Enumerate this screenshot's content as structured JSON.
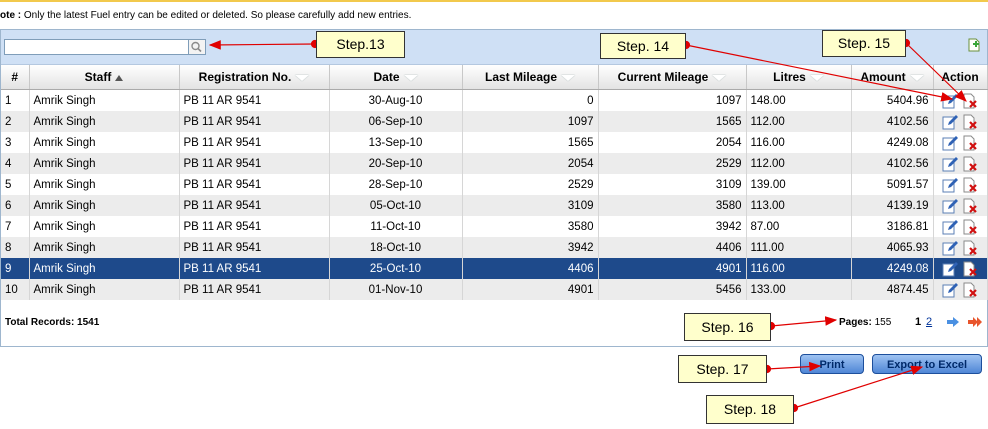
{
  "note": {
    "label": "ote :",
    "text": "Only the latest Fuel entry can be edited or deleted. So please carefully add new entries."
  },
  "search": {
    "value": "",
    "placeholder": ""
  },
  "columns": [
    "#",
    "Staff",
    "Registration No.",
    "Date",
    "Last Mileage",
    "Current Mileage",
    "Litres",
    "Amount",
    "Action"
  ],
  "rows": [
    {
      "n": "1",
      "staff": "Amrik Singh",
      "reg": "PB 11 AR 9541",
      "date": "30-Aug-10",
      "last": "0",
      "curr": "1097",
      "litres": "148.00",
      "amount": "5404.96"
    },
    {
      "n": "2",
      "staff": "Amrik Singh",
      "reg": "PB 11 AR 9541",
      "date": "06-Sep-10",
      "last": "1097",
      "curr": "1565",
      "litres": "112.00",
      "amount": "4102.56"
    },
    {
      "n": "3",
      "staff": "Amrik Singh",
      "reg": "PB 11 AR 9541",
      "date": "13-Sep-10",
      "last": "1565",
      "curr": "2054",
      "litres": "116.00",
      "amount": "4249.08"
    },
    {
      "n": "4",
      "staff": "Amrik Singh",
      "reg": "PB 11 AR 9541",
      "date": "20-Sep-10",
      "last": "2054",
      "curr": "2529",
      "litres": "112.00",
      "amount": "4102.56"
    },
    {
      "n": "5",
      "staff": "Amrik Singh",
      "reg": "PB 11 AR 9541",
      "date": "28-Sep-10",
      "last": "2529",
      "curr": "3109",
      "litres": "139.00",
      "amount": "5091.57"
    },
    {
      "n": "6",
      "staff": "Amrik Singh",
      "reg": "PB 11 AR 9541",
      "date": "05-Oct-10",
      "last": "3109",
      "curr": "3580",
      "litres": "113.00",
      "amount": "4139.19"
    },
    {
      "n": "7",
      "staff": "Amrik Singh",
      "reg": "PB 11 AR 9541",
      "date": "11-Oct-10",
      "last": "3580",
      "curr": "3942",
      "litres": "87.00",
      "amount": "3186.81"
    },
    {
      "n": "8",
      "staff": "Amrik Singh",
      "reg": "PB 11 AR 9541",
      "date": "18-Oct-10",
      "last": "3942",
      "curr": "4406",
      "litres": "111.00",
      "amount": "4065.93"
    },
    {
      "n": "9",
      "staff": "Amrik Singh",
      "reg": "PB 11 AR 9541",
      "date": "25-Oct-10",
      "last": "4406",
      "curr": "4901",
      "litres": "116.00",
      "amount": "4249.08"
    },
    {
      "n": "10",
      "staff": "Amrik Singh",
      "reg": "PB 11 AR 9541",
      "date": "01-Nov-10",
      "last": "4901",
      "curr": "5456",
      "litres": "133.00",
      "amount": "4874.45"
    }
  ],
  "selected_row": "9",
  "footer": {
    "total": "Total Records: 1541",
    "pages_label": "Pages:",
    "pages_count": "155",
    "page1": "1",
    "page2": "2"
  },
  "buttons": {
    "print": "Print",
    "export": "Export to Excel"
  },
  "callouts": [
    "Step.13",
    "Step. 14",
    "Step. 15",
    "Step. 16",
    "Step. 17",
    "Step. 18"
  ],
  "colors": {
    "header_bar": "#cfe0f5",
    "selected_row": "#1e4a8b",
    "callout_bg": "#ffffcc",
    "arrow": "#e00000",
    "button": "#4f86d6"
  },
  "icons": {
    "search": "search-icon",
    "add": "add-record-icon",
    "edit": "edit-icon",
    "delete": "delete-icon",
    "next": "next-page-icon",
    "last": "last-page-icon"
  }
}
